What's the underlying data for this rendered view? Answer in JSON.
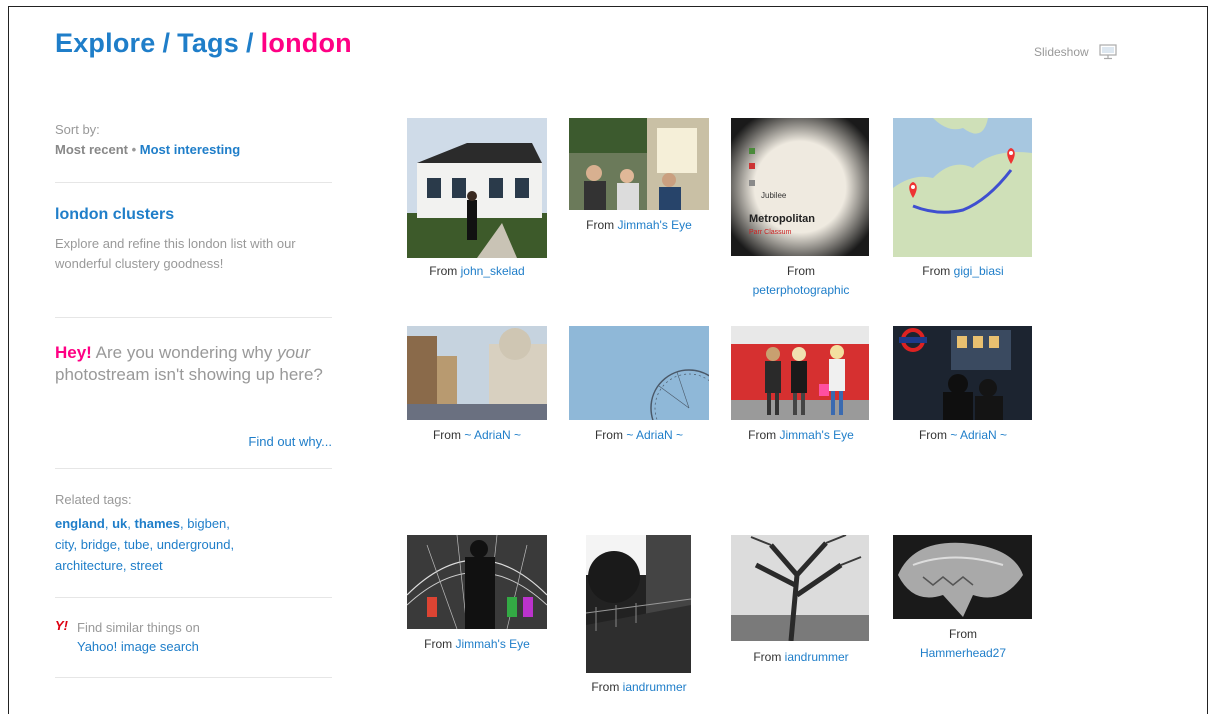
{
  "header": {
    "crumb_explore": "Explore",
    "crumb_sep1": "/",
    "crumb_tags": "Tags",
    "crumb_sep2": "/",
    "crumb_tag": "london",
    "slideshow_label": "Slideshow",
    "slideshow_icon": "monitor-icon"
  },
  "sidebar": {
    "sort_label": "Sort by:",
    "sort_recent": "Most recent",
    "sort_dot": "•",
    "sort_interesting": "Most interesting",
    "clusters_title": "london clusters",
    "clusters_desc": "Explore and refine this london list with our wonderful clustery goodness!",
    "hey_word": "Hey!",
    "hey_text1": " Are you wondering why ",
    "hey_italic": "your",
    "hey_text2": " photostream isn't showing up here?",
    "find_out": "Find out why...",
    "related_label": "Related tags:",
    "related_tags": [
      "england",
      "uk",
      "thames",
      "bigben",
      "city",
      "bridge",
      "tube",
      "underground",
      "architecture",
      "street"
    ],
    "yahoo_icon": "Y!",
    "yahoo_text": "Find similar things on",
    "yahoo_link": "Yahoo! image search"
  },
  "photos": [
    {
      "from": "From",
      "user": "john_skelad",
      "subject": "white house with man"
    },
    {
      "from": "From",
      "user": "Jimmah's Eye",
      "subject": "pub street crowd"
    },
    {
      "from": "From",
      "user": "peterphotographic",
      "subject": "tube map Metropolitan line"
    },
    {
      "from": "From",
      "user": "gigi_biasi",
      "subject": "map of Europe route"
    },
    {
      "from": "From",
      "user": "~ AdriaN ~",
      "subject": "london street buildings"
    },
    {
      "from": "From",
      "user": "~ AdriaN ~",
      "subject": "London Eye against sky"
    },
    {
      "from": "From",
      "user": "Jimmah's Eye",
      "subject": "two girls by red bus"
    },
    {
      "from": "From",
      "user": "~ AdriaN ~",
      "subject": "underground sign night"
    },
    {
      "from": "From",
      "user": "Jimmah's Eye",
      "subject": "couple silhouette station"
    },
    {
      "from": "From",
      "user": "iandrummer",
      "subject": "black and white alley"
    },
    {
      "from": "From",
      "user": "iandrummer",
      "subject": "bare tree black and white"
    },
    {
      "from": "From",
      "user": "Hammerhead27",
      "subject": "alien sculpture head"
    }
  ],
  "map_text": {
    "metropolitan": "Metropolitan",
    "parr_classum": "Parr Classum",
    "jubilee": "Jubilee"
  }
}
